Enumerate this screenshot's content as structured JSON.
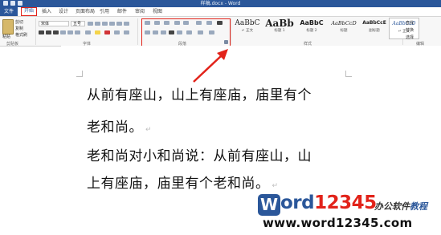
{
  "window": {
    "title": "样稿.docx - Word",
    "accent_color": "#2b579a",
    "highlight_color": "#e2231a"
  },
  "tabs": [
    {
      "label": "文件"
    },
    {
      "label": "开始"
    },
    {
      "label": "插入"
    },
    {
      "label": "设计"
    },
    {
      "label": "页面布局"
    },
    {
      "label": "引用"
    },
    {
      "label": "邮件"
    },
    {
      "label": "审阅"
    },
    {
      "label": "视图"
    }
  ],
  "clipboard": {
    "paste_label": "粘贴",
    "cut_label": "剪切",
    "copy_label": "复制",
    "format_painter_label": "格式刷",
    "group_label": "剪贴板"
  },
  "font": {
    "family_value": "宋体",
    "size_value": "五号",
    "group_label": "字体"
  },
  "paragraph": {
    "group_label": "段落"
  },
  "styles": {
    "group_label": "样式",
    "items": [
      {
        "sample": "AaBbC",
        "name": "↵ 正文"
      },
      {
        "sample": "AaBb",
        "name": "标题 1"
      },
      {
        "sample": "AaBbC",
        "name": "标题 2"
      },
      {
        "sample": "AaBbCcD",
        "name": "标题"
      },
      {
        "sample": "AaBbCcE",
        "name": "副标题"
      },
      {
        "sample": "AaBbCcD",
        "name": "↵ 正文"
      }
    ]
  },
  "editing": {
    "find_label": "查找",
    "replace_label": "替换",
    "select_label": "选择",
    "group_label": "编辑"
  },
  "document": {
    "lines": [
      "从前有座山，山上有座庙，庙里有个",
      "老和尚。",
      "老和尚对小和尚说：从前有座山，山",
      "上有座庙，庙里有个老和尚。"
    ]
  },
  "watermark": {
    "logo_letter": "W",
    "logo_word": "ord",
    "logo_number": "12345",
    "slogan_a": "办公软件",
    "slogan_b": "教程",
    "url": "www.word12345.com"
  }
}
